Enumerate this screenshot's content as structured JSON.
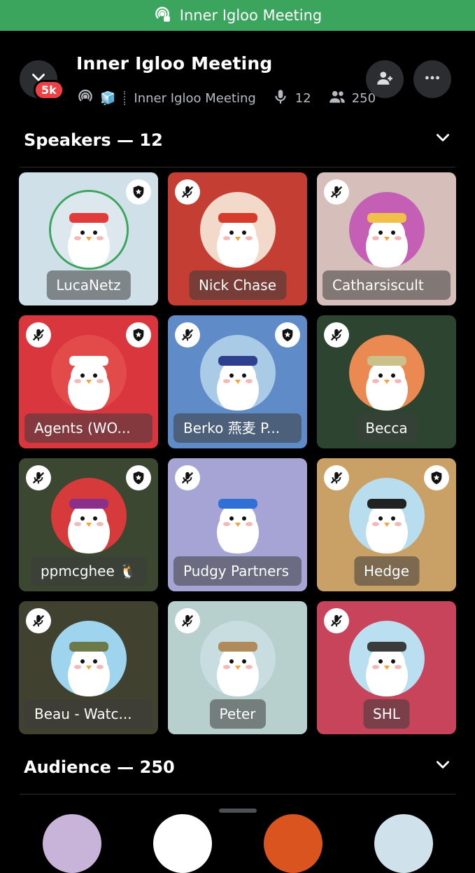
{
  "banner": {
    "label": "Inner Igloo Meeting"
  },
  "header": {
    "title": "Inner Igloo Meeting",
    "badge": "5k",
    "emoji": "🧊",
    "channel_name": "Inner Igloo Meeting",
    "speaker_count": "12",
    "listener_count": "250"
  },
  "speakers_section": {
    "label": "Speakers — 12"
  },
  "audience_section": {
    "label": "Audience — 250"
  },
  "speakers": [
    {
      "name": "LucaNetz",
      "bg": "#cfe0e8",
      "avatar_bg": "#dce8ee",
      "muted": false,
      "mod": true,
      "speaking": true
    },
    {
      "name": "Nick Chase",
      "bg": "#c43e33",
      "avatar_bg": "#f2d9c9",
      "muted": true,
      "mod": false,
      "speaking": false
    },
    {
      "name": "Catharsiscult",
      "bg": "#d6bfbb",
      "avatar_bg": "#c45fb5",
      "muted": true,
      "mod": false,
      "speaking": false
    },
    {
      "name": "Agents (WO...",
      "bg": "#d9363e",
      "avatar_bg": "#e34a4a",
      "muted": true,
      "mod": true,
      "speaking": false
    },
    {
      "name": "Berko 燕麦 P...",
      "bg": "#5f8cc9",
      "avatar_bg": "#a9cbe6",
      "muted": true,
      "mod": true,
      "speaking": false
    },
    {
      "name": "Becca",
      "bg": "#2d4530",
      "avatar_bg": "#ea8a52",
      "muted": true,
      "mod": false,
      "speaking": false
    },
    {
      "name": "ppmcghee 🐧",
      "bg": "#3b4730",
      "avatar_bg": "#d73a3a",
      "muted": true,
      "mod": true,
      "speaking": false
    },
    {
      "name": "Pudgy Partners",
      "bg": "#a5a4d4",
      "avatar_bg": "#a5a4d4",
      "muted": true,
      "mod": false,
      "speaking": false
    },
    {
      "name": "Hedge",
      "bg": "#c9a167",
      "avatar_bg": "#b8ddef",
      "muted": true,
      "mod": true,
      "speaking": false
    },
    {
      "name": "Beau - Watc...",
      "bg": "#40422f",
      "avatar_bg": "#9fd4ef",
      "muted": true,
      "mod": false,
      "speaking": false
    },
    {
      "name": "Peter",
      "bg": "#b7cfcd",
      "avatar_bg": "#c8dde0",
      "muted": true,
      "mod": false,
      "speaking": false
    },
    {
      "name": "SHL",
      "bg": "#c8445a",
      "avatar_bg": "#b9dff0",
      "muted": true,
      "mod": false,
      "speaking": false
    }
  ],
  "colors": {
    "accent_green": "#3ba55d",
    "badge_red": "#ed4245",
    "surface": "#2b2d31"
  }
}
